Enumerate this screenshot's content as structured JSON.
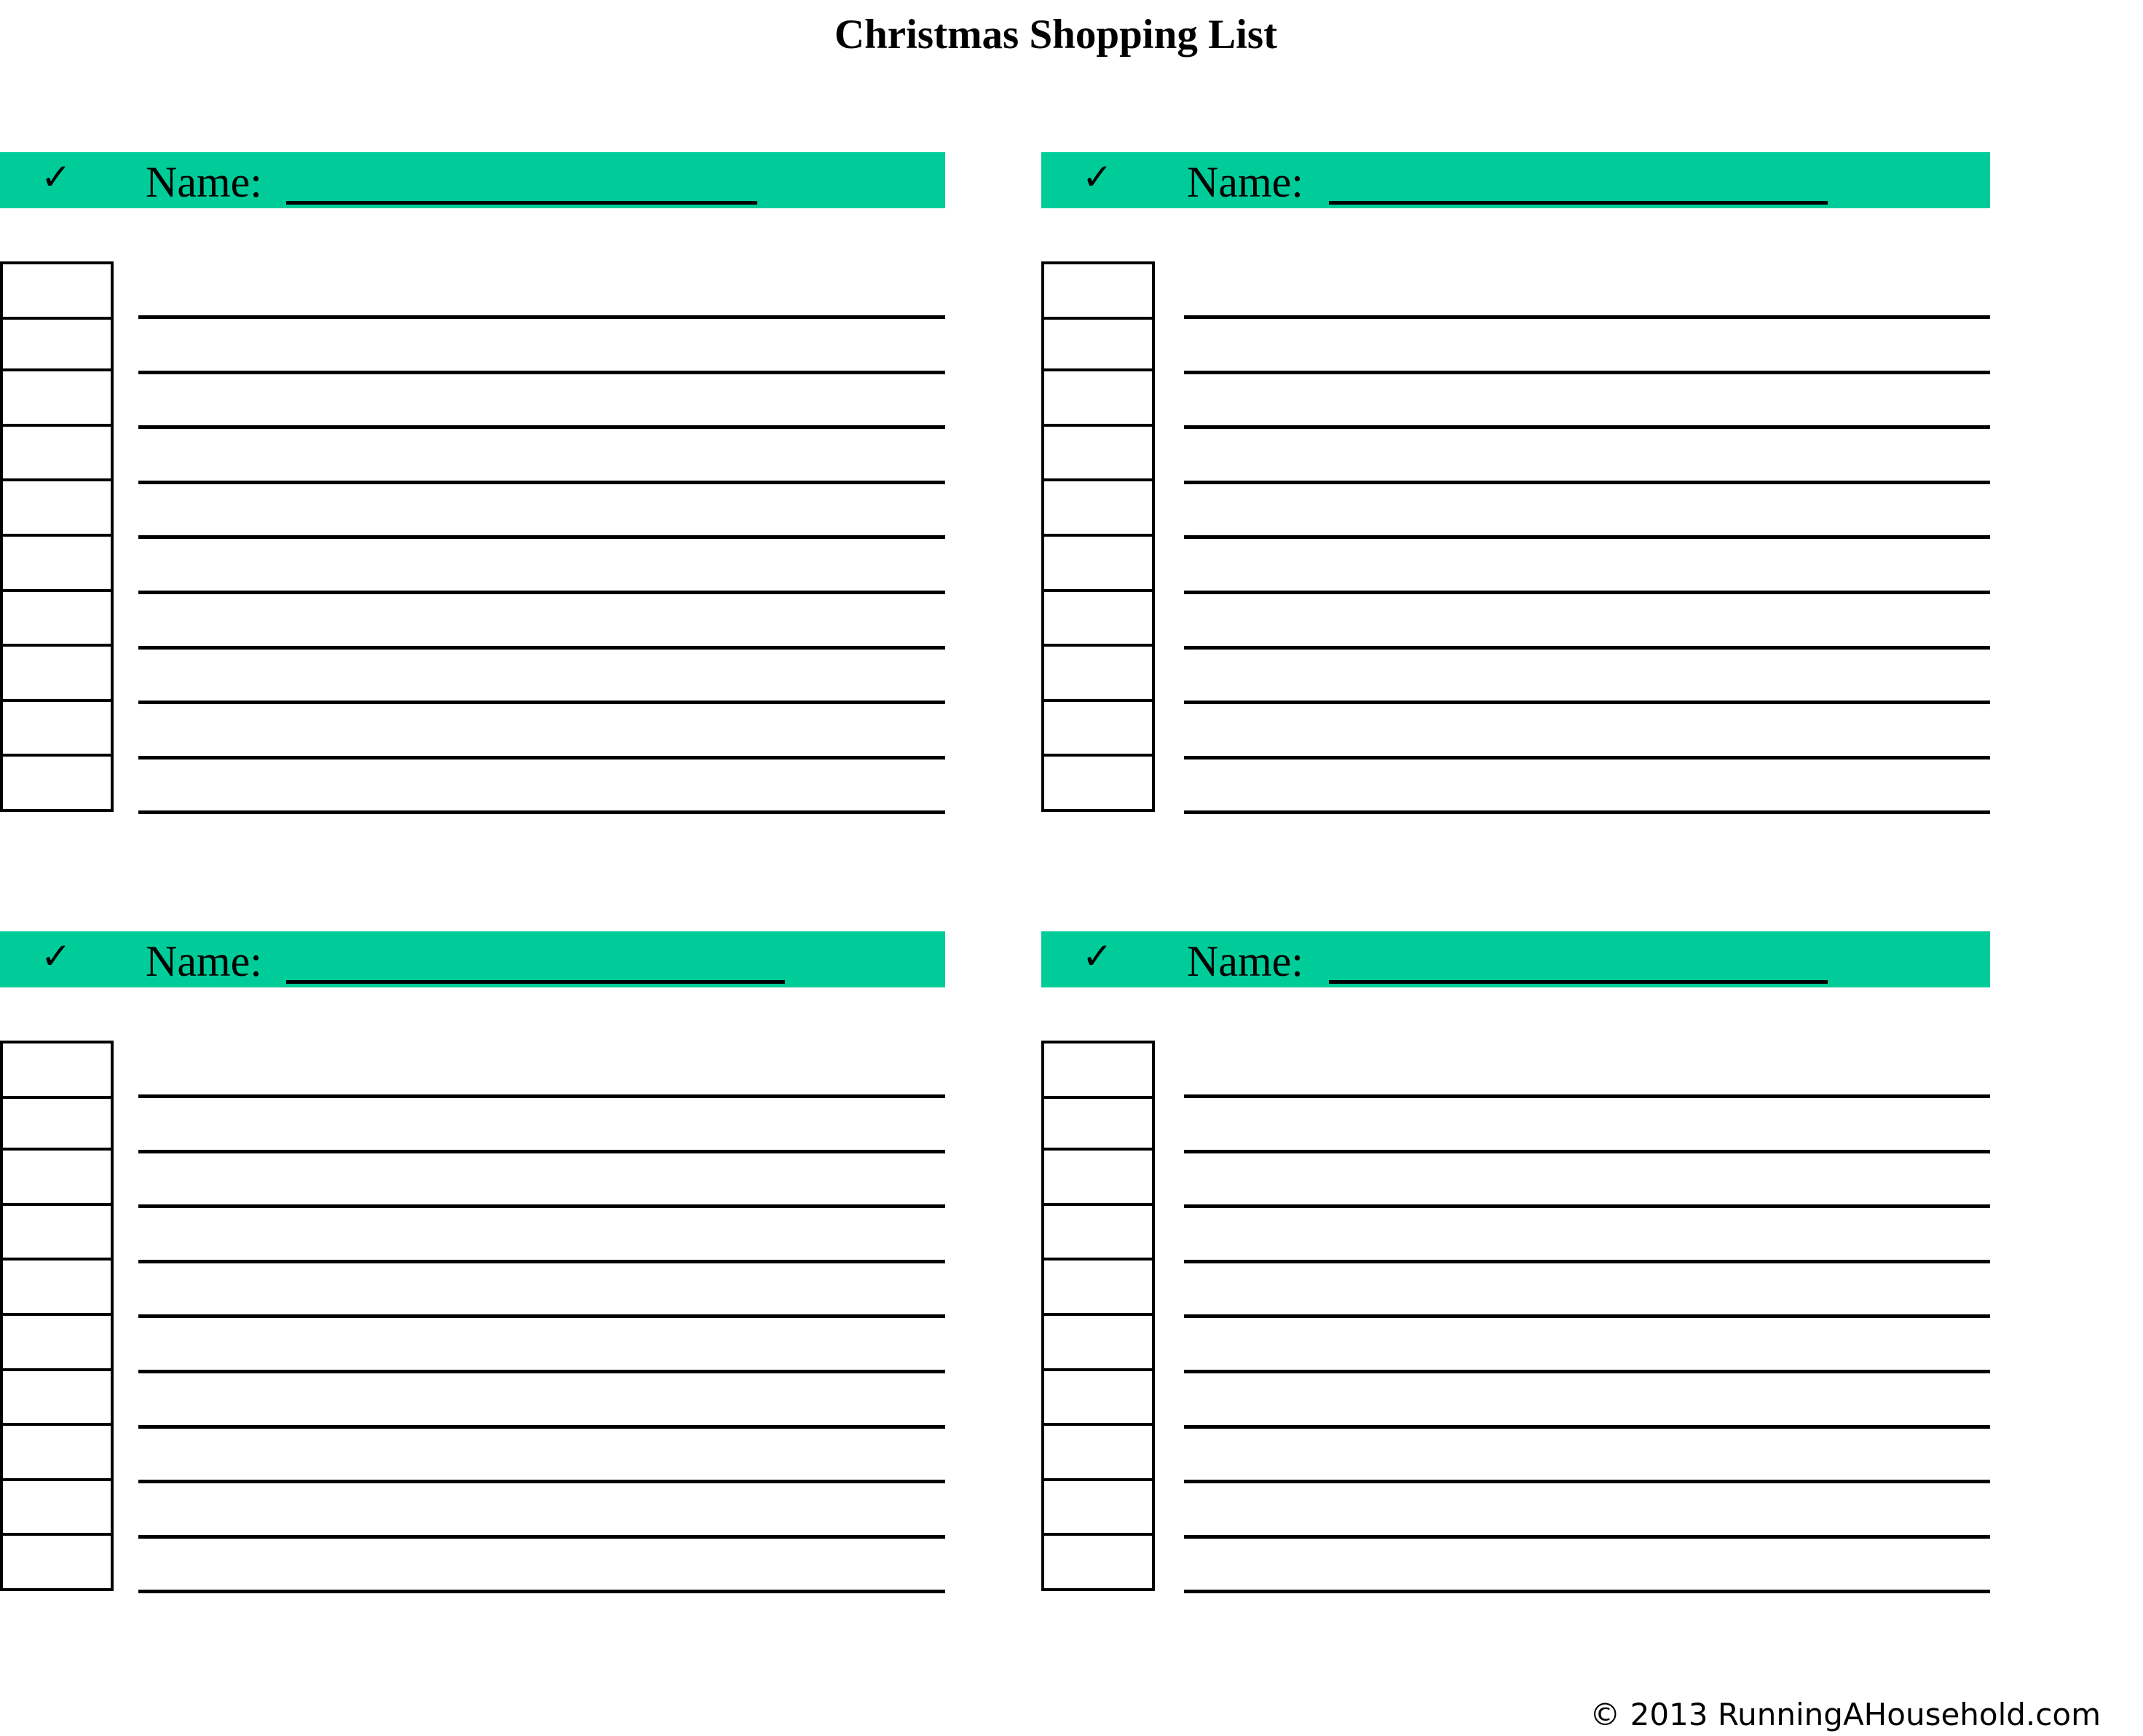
{
  "title": "Christmas Shopping List",
  "accent_color": "#00cc99",
  "lists": [
    {
      "position": "top-left",
      "check_icon": "check-mark-icon",
      "check_glyph": "✓",
      "name_label": "Name:",
      "name_value": "",
      "items": [
        "",
        "",
        "",
        "",
        "",
        "",
        "",
        "",
        "",
        ""
      ],
      "checked": [
        false,
        false,
        false,
        false,
        false,
        false,
        false,
        false,
        false,
        false
      ]
    },
    {
      "position": "top-right",
      "check_icon": "check-mark-icon",
      "check_glyph": "✓",
      "name_label": "Name:",
      "name_value": "",
      "items": [
        "",
        "",
        "",
        "",
        "",
        "",
        "",
        "",
        "",
        ""
      ],
      "checked": [
        false,
        false,
        false,
        false,
        false,
        false,
        false,
        false,
        false,
        false
      ]
    },
    {
      "position": "bottom-left",
      "check_icon": "check-mark-icon",
      "check_glyph": "✓",
      "name_label": "Name:",
      "name_value": "",
      "items": [
        "",
        "",
        "",
        "",
        "",
        "",
        "",
        "",
        "",
        ""
      ],
      "checked": [
        false,
        false,
        false,
        false,
        false,
        false,
        false,
        false,
        false,
        false
      ]
    },
    {
      "position": "bottom-right",
      "check_icon": "check-mark-icon",
      "check_glyph": "✓",
      "name_label": "Name:",
      "name_value": "",
      "items": [
        "",
        "",
        "",
        "",
        "",
        "",
        "",
        "",
        "",
        ""
      ],
      "checked": [
        false,
        false,
        false,
        false,
        false,
        false,
        false,
        false,
        false,
        false
      ]
    }
  ],
  "footer": {
    "copyright": "© 2013 RunningAHousehold.com"
  }
}
